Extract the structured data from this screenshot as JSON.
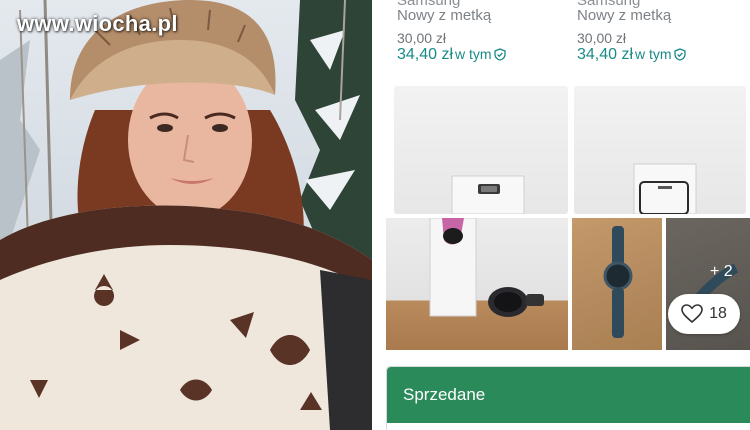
{
  "photo": {
    "watermark": "www.wiocha.pl",
    "scarf_pattern": "brown-monogram-scarf"
  },
  "listings": [
    {
      "brand": "Samsung",
      "condition": "Nowy z metką",
      "price": "30,00 zł",
      "price_total": "34,40 zł",
      "price_total_suffix": "w tym"
    },
    {
      "brand": "Samsung",
      "condition": "Nowy z metką",
      "price": "30,00 zł",
      "price_total": "34,40 zł",
      "price_total_suffix": "w tym"
    }
  ],
  "gallery": {
    "more_photos": "+ 2",
    "favorites": "18"
  },
  "status": {
    "label": "Sprzedane"
  },
  "colors": {
    "accent_teal": "#1a8a88",
    "sold_green": "#2b8a5a"
  }
}
